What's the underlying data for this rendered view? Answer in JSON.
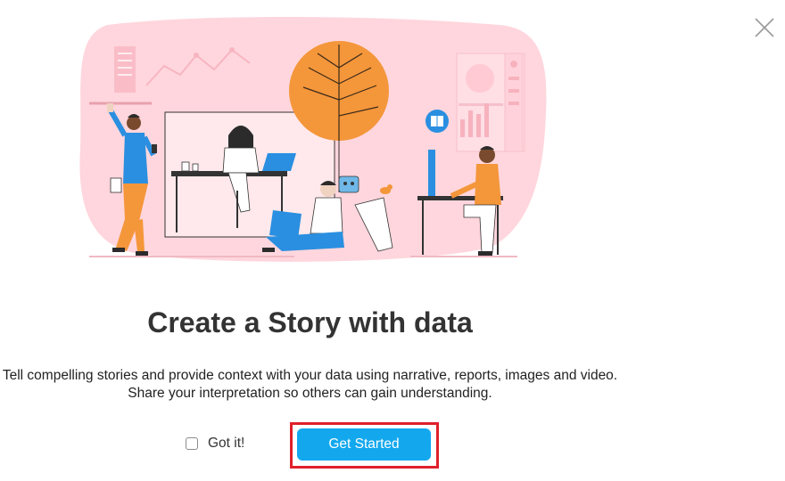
{
  "dialog": {
    "title": "Create a Story with data",
    "description_line1": "Tell compelling stories and provide context with your data using narrative, reports, images and video.",
    "description_line2": "Share your interpretation so others can gain understanding.",
    "got_it_label": "Got it!",
    "got_it_checked": false,
    "get_started_label": "Get Started"
  },
  "icons": {
    "close": "close-icon",
    "illustration": "team-working-with-data-illustration"
  },
  "colors": {
    "primary_button": "#13a8ee",
    "highlight_border": "#e0202a",
    "illustration_background": "#ffd6dd",
    "accent_orange": "#f4963a",
    "accent_blue": "#2a8fe0",
    "title_text": "#333333"
  }
}
